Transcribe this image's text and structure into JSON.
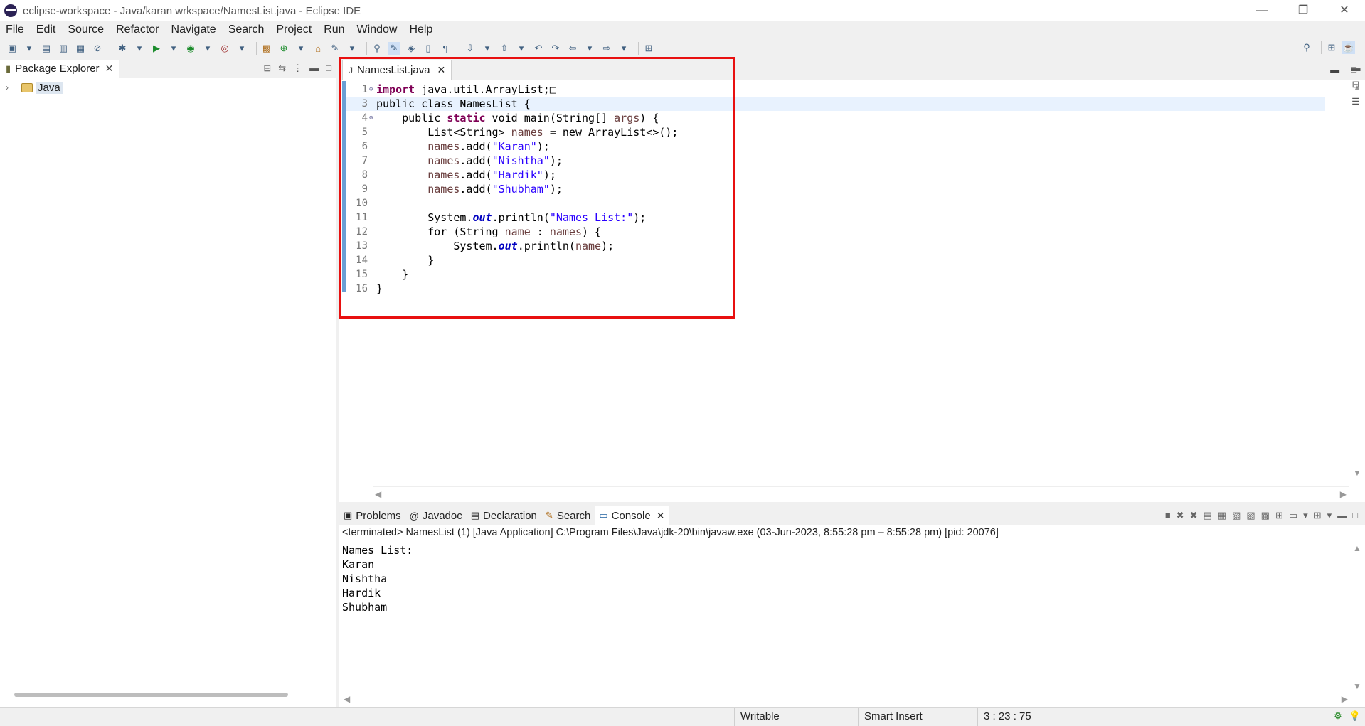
{
  "window": {
    "title": "eclipse-workspace - Java/karan wrkspace/NamesList.java - Eclipse IDE",
    "minimize": "—",
    "restore": "❐",
    "close": "✕"
  },
  "menu": [
    "File",
    "Edit",
    "Source",
    "Refactor",
    "Navigate",
    "Search",
    "Project",
    "Run",
    "Window",
    "Help"
  ],
  "package_explorer": {
    "tab_label": "Package Explorer",
    "close": "✕",
    "tree": [
      {
        "label": "Java",
        "expanded": false
      }
    ]
  },
  "editor": {
    "tab_label": "NamesList.java",
    "close": "✕",
    "lines": [
      {
        "n": "1",
        "fold": "⊕",
        "code": "import java.util.ArrayList;□"
      },
      {
        "n": "3",
        "fold": "",
        "code": "public class NamesList {"
      },
      {
        "n": "4",
        "fold": "⊖",
        "code": "    public static void main(String[] args) {"
      },
      {
        "n": "5",
        "fold": "",
        "code": "        List<String> names = new ArrayList<>();"
      },
      {
        "n": "6",
        "fold": "",
        "code": "        names.add(\"Karan\");"
      },
      {
        "n": "7",
        "fold": "",
        "code": "        names.add(\"Nishtha\");"
      },
      {
        "n": "8",
        "fold": "",
        "code": "        names.add(\"Hardik\");"
      },
      {
        "n": "9",
        "fold": "",
        "code": "        names.add(\"Shubham\");"
      },
      {
        "n": "10",
        "fold": "",
        "code": ""
      },
      {
        "n": "11",
        "fold": "",
        "code": "        System.out.println(\"Names List:\");"
      },
      {
        "n": "12",
        "fold": "",
        "code": "        for (String name : names) {"
      },
      {
        "n": "13",
        "fold": "",
        "code": "            System.out.println(name);"
      },
      {
        "n": "14",
        "fold": "",
        "code": "        }"
      },
      {
        "n": "15",
        "fold": "",
        "code": "    }"
      },
      {
        "n": "16",
        "fold": "",
        "code": "}"
      }
    ]
  },
  "bottom_tabs": [
    {
      "label": "Problems",
      "icon": "problems-icon"
    },
    {
      "label": "Javadoc",
      "icon": "javadoc-icon"
    },
    {
      "label": "Declaration",
      "icon": "declaration-icon"
    },
    {
      "label": "Search",
      "icon": "search-icon"
    },
    {
      "label": "Console",
      "icon": "console-icon",
      "active": true
    }
  ],
  "console": {
    "close": "✕",
    "status": "<terminated> NamesList (1) [Java Application] C:\\Program Files\\Java\\jdk-20\\bin\\javaw.exe  (03-Jun-2023, 8:55:28 pm – 8:55:28 pm) [pid: 20076]",
    "output": [
      "Names List:",
      "Karan",
      "Nishtha",
      "Hardik",
      "Shubham"
    ]
  },
  "statusbar": {
    "mode": "Writable",
    "insert": "Smart Insert",
    "position": "3 : 23 : 75"
  },
  "colors": {
    "highlight_box": "#e81010",
    "keyword": "#7f0055",
    "string": "#2a00ff",
    "current_line": "#e8f2fe"
  }
}
